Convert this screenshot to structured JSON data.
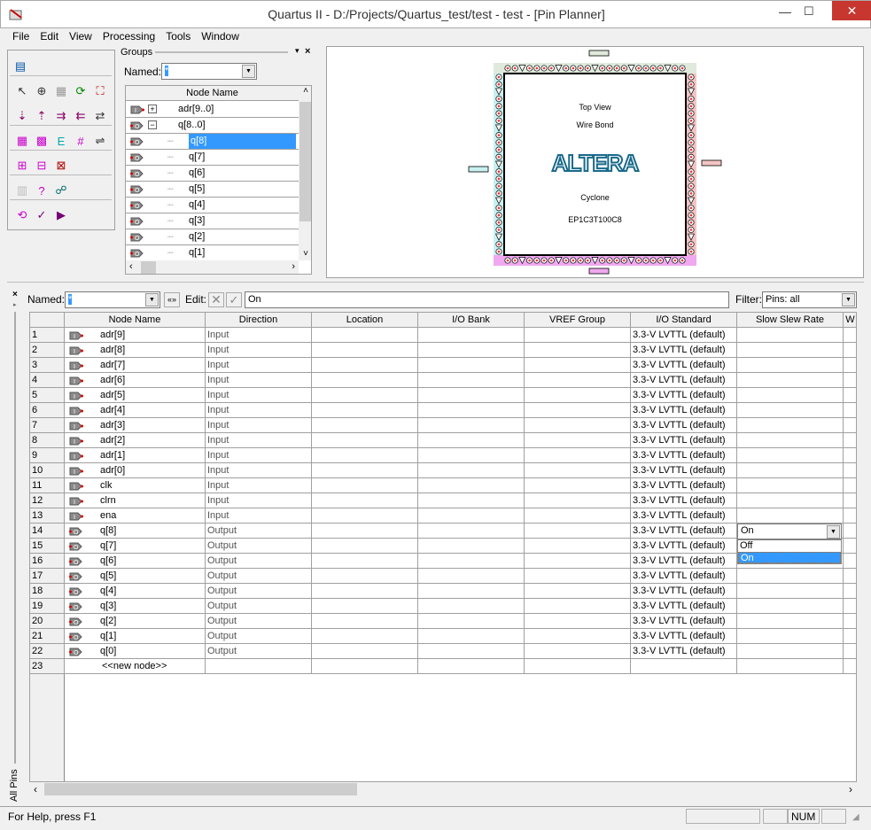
{
  "window": {
    "title": "Quartus II - D:/Projects/Quartus_test/test - test - [Pin Planner]"
  },
  "menu": [
    "File",
    "Edit",
    "View",
    "Processing",
    "Tools",
    "Window"
  ],
  "groups": {
    "title": "Groups",
    "named_label": "Named:",
    "named_value": "*",
    "header": "Node Name",
    "items": [
      {
        "label": "adr[9..0]",
        "type": "input-group",
        "expander": "+"
      },
      {
        "label": "q[8..0]",
        "type": "output-group",
        "expander": "−"
      },
      {
        "label": "q[8]",
        "selected": true
      },
      {
        "label": "q[7]"
      },
      {
        "label": "q[6]"
      },
      {
        "label": "q[5]"
      },
      {
        "label": "q[4]"
      },
      {
        "label": "q[3]"
      },
      {
        "label": "q[2]"
      },
      {
        "label": "q[1]"
      }
    ]
  },
  "chip": {
    "view": "Top View",
    "bond": "Wire Bond",
    "logo": "ALTERA",
    "family": "Cyclone",
    "device": "EP1C3T100C8"
  },
  "filterbar": {
    "named_label": "Named:",
    "named_value": "*",
    "edit_label": "Edit:",
    "edit_value": "On",
    "filter_label": "Filter:",
    "filter_value": "Pins: all"
  },
  "table": {
    "columns": [
      "",
      "Node Name",
      "Direction",
      "Location",
      "I/O Bank",
      "VREF Group",
      "I/O Standard",
      "Slow Slew Rate",
      "W"
    ],
    "rows": [
      {
        "n": "1",
        "name": "adr[9]",
        "dir": "Input",
        "std": "3.3-V LVTTL (default)",
        "t": "i"
      },
      {
        "n": "2",
        "name": "adr[8]",
        "dir": "Input",
        "std": "3.3-V LVTTL (default)",
        "t": "i"
      },
      {
        "n": "3",
        "name": "adr[7]",
        "dir": "Input",
        "std": "3.3-V LVTTL (default)",
        "t": "i"
      },
      {
        "n": "4",
        "name": "adr[6]",
        "dir": "Input",
        "std": "3.3-V LVTTL (default)",
        "t": "i"
      },
      {
        "n": "5",
        "name": "adr[5]",
        "dir": "Input",
        "std": "3.3-V LVTTL (default)",
        "t": "i"
      },
      {
        "n": "6",
        "name": "adr[4]",
        "dir": "Input",
        "std": "3.3-V LVTTL (default)",
        "t": "i"
      },
      {
        "n": "7",
        "name": "adr[3]",
        "dir": "Input",
        "std": "3.3-V LVTTL (default)",
        "t": "i"
      },
      {
        "n": "8",
        "name": "adr[2]",
        "dir": "Input",
        "std": "3.3-V LVTTL (default)",
        "t": "i"
      },
      {
        "n": "9",
        "name": "adr[1]",
        "dir": "Input",
        "std": "3.3-V LVTTL (default)",
        "t": "i"
      },
      {
        "n": "10",
        "name": "adr[0]",
        "dir": "Input",
        "std": "3.3-V LVTTL (default)",
        "t": "i"
      },
      {
        "n": "11",
        "name": "clk",
        "dir": "Input",
        "std": "3.3-V LVTTL (default)",
        "t": "i"
      },
      {
        "n": "12",
        "name": "clrn",
        "dir": "Input",
        "std": "3.3-V LVTTL (default)",
        "t": "i"
      },
      {
        "n": "13",
        "name": "ena",
        "dir": "Input",
        "std": "3.3-V LVTTL (default)",
        "t": "i"
      },
      {
        "n": "14",
        "name": "q[8]",
        "dir": "Output",
        "std": "3.3-V LVTTL (default)",
        "t": "o"
      },
      {
        "n": "15",
        "name": "q[7]",
        "dir": "Output",
        "std": "3.3-V LVTTL (default)",
        "t": "o"
      },
      {
        "n": "16",
        "name": "q[6]",
        "dir": "Output",
        "std": "3.3-V LVTTL (default)",
        "t": "o"
      },
      {
        "n": "17",
        "name": "q[5]",
        "dir": "Output",
        "std": "3.3-V LVTTL (default)",
        "t": "o"
      },
      {
        "n": "18",
        "name": "q[4]",
        "dir": "Output",
        "std": "3.3-V LVTTL (default)",
        "t": "o"
      },
      {
        "n": "19",
        "name": "q[3]",
        "dir": "Output",
        "std": "3.3-V LVTTL (default)",
        "t": "o"
      },
      {
        "n": "20",
        "name": "q[2]",
        "dir": "Output",
        "std": "3.3-V LVTTL (default)",
        "t": "o"
      },
      {
        "n": "21",
        "name": "q[1]",
        "dir": "Output",
        "std": "3.3-V LVTTL (default)",
        "t": "o"
      },
      {
        "n": "22",
        "name": "q[0]",
        "dir": "Output",
        "std": "3.3-V LVTTL (default)",
        "t": "o"
      },
      {
        "n": "23",
        "name": "<<new node>>",
        "dir": "",
        "std": "",
        "t": ""
      }
    ],
    "slew_editor": {
      "value": "On",
      "options": [
        "Off",
        "On"
      ],
      "selected": "On"
    }
  },
  "side_tab": "All Pins",
  "status": {
    "help": "For Help, press F1",
    "num": "NUM"
  },
  "colors": {
    "selection": "#3399ff",
    "close": "#c7372f",
    "altera": "#1a6a8a"
  }
}
